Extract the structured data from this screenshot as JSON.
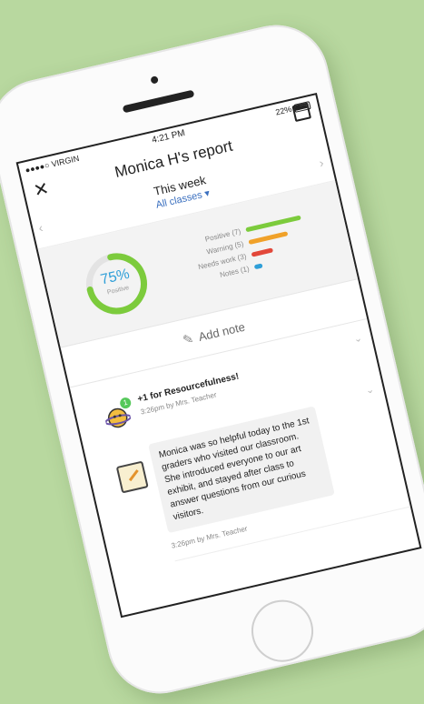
{
  "status_bar": {
    "carrier": "●●●●○ VIRGIN",
    "time": "4:21 PM",
    "battery": "22%"
  },
  "header": {
    "title": "Monica H's report",
    "close_icon": "close-icon",
    "calendar_icon": "calendar-icon"
  },
  "period": {
    "label": "This week",
    "filter": "All classes"
  },
  "summary": {
    "percent": "75%",
    "percent_label": "Positive",
    "percent_value": 0.75,
    "legend": [
      {
        "label": "Positive (7)",
        "color": "#7ccb3c",
        "fraction": 1.0
      },
      {
        "label": "Warning (5)",
        "color": "#f0a129",
        "fraction": 0.71
      },
      {
        "label": "Needs work (3)",
        "color": "#e2483a",
        "fraction": 0.39
      },
      {
        "label": "Notes (1)",
        "color": "#2f9fd8",
        "fraction": 0.14
      }
    ]
  },
  "add_note": {
    "label": "Add note"
  },
  "feed": [
    {
      "type": "award",
      "count": "1",
      "prefix": "+1 for",
      "skill": "Resourcefulness!",
      "meta": "3:26pm by Mrs. Teacher"
    },
    {
      "type": "note",
      "text": "Monica was so helpful today to the 1st graders who visited our classroom. She introduced everyone to our art exhibit, and stayed after class to answer questions from our curious visitors.",
      "meta": "3:26pm by Mrs. Teacher"
    }
  ]
}
